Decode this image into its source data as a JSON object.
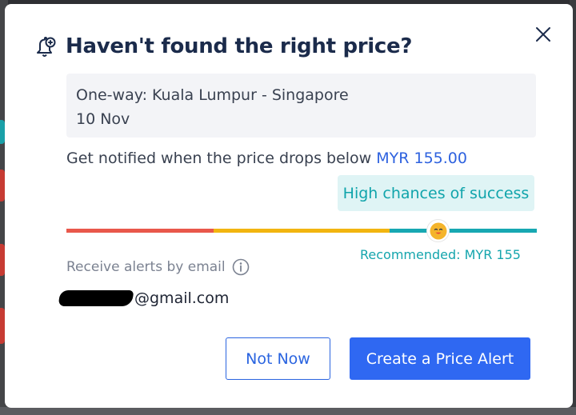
{
  "dialog": {
    "title": "Haven't found the right price?",
    "close_icon": "close-icon",
    "header_icon": "bell-plus-icon"
  },
  "route": {
    "line1": "One-way: Kuala Lumpur - Singapore",
    "line2": "10 Nov"
  },
  "notify": {
    "text": "Get notified when the price drops below ",
    "price": "MYR 155.00"
  },
  "slider": {
    "tooltip": "High chances of success",
    "recommended": "Recommended: MYR 155",
    "level_fraction": 0.79
  },
  "email": {
    "label": "Receive alerts by email",
    "info_icon": "info-icon",
    "address_visible": "@gmail.com"
  },
  "buttons": {
    "secondary": "Not Now",
    "primary": "Create a Price Alert"
  },
  "colors": {
    "primary": "#2f68f2",
    "title": "#1b2b4b",
    "teal": "#17a8b2",
    "yellow": "#f2b510",
    "red": "#e9584b"
  }
}
